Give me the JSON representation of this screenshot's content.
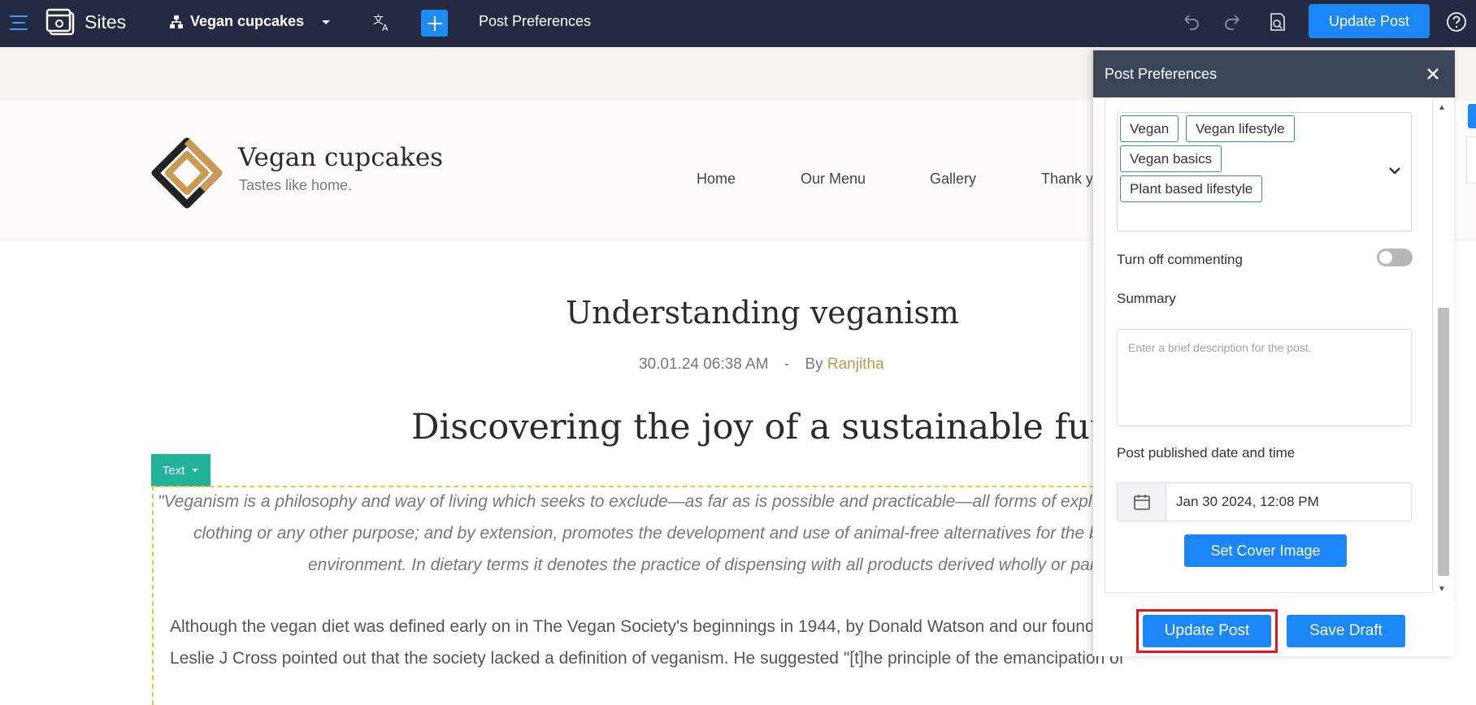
{
  "topbar": {
    "app_name": "Sites",
    "site_name": "Vegan cupcakes",
    "page_title": "Post Preferences",
    "update_label": "Update Post",
    "accent_color": "#1a86f7"
  },
  "site": {
    "name": "Vegan cupcakes",
    "tagline": "Tastes like home.",
    "nav": [
      "Home",
      "Our Menu",
      "Gallery",
      "Thank y"
    ]
  },
  "article": {
    "title": "Understanding veganism",
    "date": "30.01.24 06:38 AM",
    "separator": "-",
    "by": "By",
    "author": "Ranjitha",
    "heading": "Discovering the joy of a sustainable futur",
    "element_tag": "Text",
    "quote_lines": [
      "\"Veganism is a philosophy and way of living which seeks to exclude—as far as is possible and practicable—all forms of exploitatio",
      "clothing or any other purpose; and by extension, promotes the development and use of animal-free alternatives for the ber",
      "environment. In dietary terms it denotes the practice of dispensing with all products derived wholly or parti"
    ],
    "paragraph_lines": [
      "Although the vegan diet was defined early on in The Vegan Society's beginnings in 1944, by Donald Watson and our founding me",
      "Leslie J Cross pointed out that the society lacked a definition of veganism. He suggested \"[t]he principle of the emancipation of"
    ]
  },
  "panel": {
    "title": "Post Preferences",
    "tags": [
      "Vegan",
      "Vegan lifestyle",
      "Vegan basics",
      "Plant based lifestyle"
    ],
    "commenting_label": "Turn off commenting",
    "commenting_off": false,
    "summary_label": "Summary",
    "summary_placeholder": "Enter a brief description for the post.",
    "published_label": "Post published date and time",
    "published_value": "Jan 30 2024, 12:08 PM",
    "cover_label": "Set Cover Image",
    "update_label": "Update Post",
    "draft_label": "Save Draft"
  }
}
